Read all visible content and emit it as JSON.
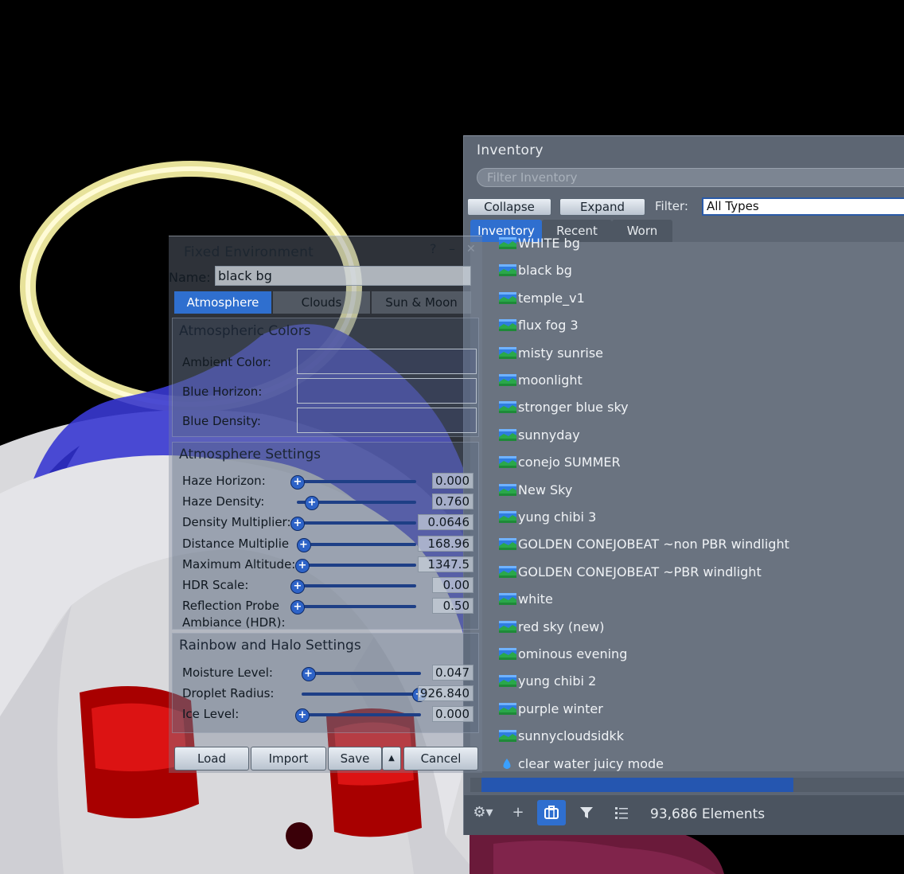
{
  "inventory": {
    "title": "Inventory",
    "search_placeholder": "Filter Inventory",
    "collapse_label": "Collapse",
    "expand_label": "Expand",
    "filter_label": "Filter:",
    "filter_value": "All Types",
    "tabs": [
      {
        "label": "Inventory",
        "active": true
      },
      {
        "label": "Recent",
        "active": false
      },
      {
        "label": "Worn",
        "active": false
      }
    ],
    "items": [
      {
        "label": "WHITE bg",
        "icon": "sky-settings-icon"
      },
      {
        "label": "black bg",
        "icon": "sky-settings-icon"
      },
      {
        "label": "temple_v1",
        "icon": "sky-settings-icon"
      },
      {
        "label": "flux fog 3",
        "icon": "sky-settings-icon"
      },
      {
        "label": "misty sunrise",
        "icon": "sky-settings-icon"
      },
      {
        "label": "moonlight",
        "icon": "sky-settings-icon"
      },
      {
        "label": "stronger blue sky",
        "icon": "sky-settings-icon"
      },
      {
        "label": "sunnyday",
        "icon": "sky-settings-icon"
      },
      {
        "label": "conejo SUMMER",
        "icon": "sky-settings-icon"
      },
      {
        "label": "New Sky",
        "icon": "sky-settings-icon"
      },
      {
        "label": "yung chibi 3",
        "icon": "sky-settings-icon"
      },
      {
        "label": "GOLDEN CONEJOBEAT ~non PBR windlight",
        "icon": "sky-settings-icon"
      },
      {
        "label": "GOLDEN CONEJOBEAT ~PBR windlight",
        "icon": "sky-settings-icon"
      },
      {
        "label": "white",
        "icon": "sky-settings-icon"
      },
      {
        "label": "red sky (new)",
        "icon": "sky-settings-icon"
      },
      {
        "label": "ominous evening",
        "icon": "sky-settings-icon"
      },
      {
        "label": "yung chibi 2",
        "icon": "sky-settings-icon"
      },
      {
        "label": "purple winter",
        "icon": "sky-settings-icon"
      },
      {
        "label": "sunnycloudsidkk",
        "icon": "sky-settings-icon"
      },
      {
        "label": "clear water juicy mode",
        "icon": "water-settings-icon"
      }
    ],
    "element_count": "93,686 Elements",
    "bottom_icons": [
      "gear-icon",
      "plus-icon",
      "inventory-icon",
      "filter-icon",
      "list-icon"
    ]
  },
  "environment": {
    "title": "Fixed Environment",
    "help": "?",
    "minimize": "–",
    "close": "✕",
    "name_label": "Name:",
    "name_value": "black bg",
    "tabs": [
      {
        "label": "Atmosphere",
        "active": true
      },
      {
        "label": "Clouds",
        "active": false
      },
      {
        "label": "Sun & Moon",
        "active": false
      }
    ],
    "atmospheric_colors": {
      "title": "Atmospheric Colors",
      "rows": [
        {
          "label": "Ambient Color:"
        },
        {
          "label": "Blue Horizon:"
        },
        {
          "label": "Blue Density:"
        }
      ]
    },
    "atmosphere_settings": {
      "title": "Atmosphere Settings",
      "sliders": [
        {
          "label": "Haze Horizon:",
          "value": "0.000",
          "level": 0.0
        },
        {
          "label": "Haze Density:",
          "value": "0.760",
          "level": 0.12
        },
        {
          "label": "Density Multiplier:",
          "value": "0.0646",
          "level": 0.0
        },
        {
          "label": "Distance Multiplie",
          "value": "168.96",
          "level": 0.05
        },
        {
          "label": "Maximum Altitude:",
          "value": "1347.5",
          "level": 0.04
        },
        {
          "label": "HDR Scale:",
          "value": "0.00",
          "level": 0.0
        },
        {
          "label": "Reflection Probe",
          "label2": "Ambiance (HDR):",
          "value": "0.50",
          "level": 0.0
        }
      ]
    },
    "rainbow_halo": {
      "title": "Rainbow and Halo Settings",
      "sliders": [
        {
          "label": "Moisture Level:",
          "value": "0.047",
          "level": 0.05
        },
        {
          "label": "Droplet Radius:",
          "value": "926.840",
          "level": 0.98
        },
        {
          "label": "Ice Level:",
          "value": "0.000",
          "level": 0.0
        }
      ]
    },
    "buttons": {
      "load": "Load",
      "import": "Import",
      "save": "Save",
      "save_arrow": "▲",
      "cancel": "Cancel"
    }
  },
  "colors": {
    "accent": "#2f6fcf",
    "halo": "#f5f0a0",
    "ribbon": "#3a3ad8",
    "eye": "#b00000"
  }
}
